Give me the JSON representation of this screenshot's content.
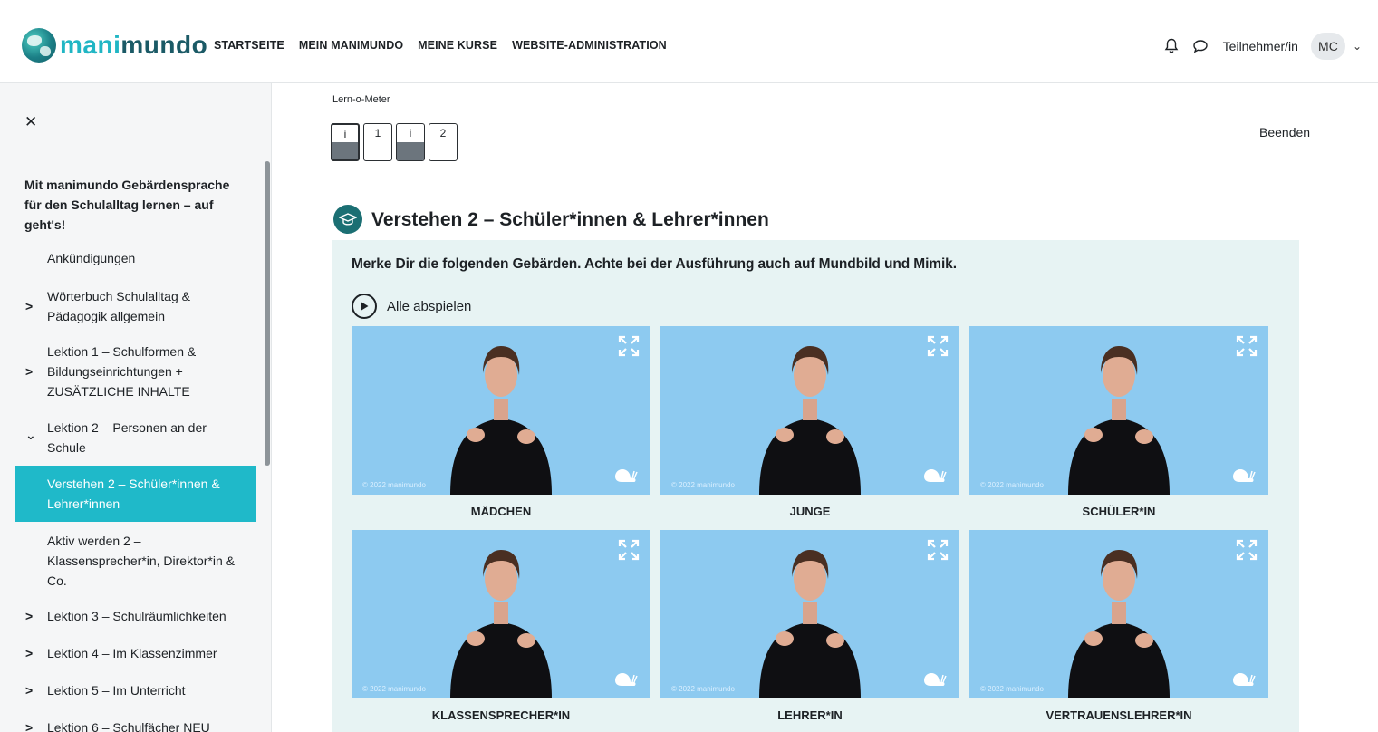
{
  "brand": {
    "logo_part1": "mani",
    "logo_part2": "mundo"
  },
  "topnav": {
    "items": [
      "STARTSEITE",
      "MEIN MANIMUNDO",
      "MEINE KURSE",
      "WEBSITE-ADMINISTRATION"
    ]
  },
  "user": {
    "role": "Teilnehmer/in",
    "initials": "MC"
  },
  "sidebar": {
    "course_title": "Mit manimundo Gebärdensprache für den Schulalltag lernen – auf geht's!",
    "items": [
      {
        "label": "Ankündigungen",
        "arrow": ""
      },
      {
        "label": "Wörterbuch Schulalltag & Pädagogik allgemein",
        "arrow": ">"
      },
      {
        "label": "Lektion 1 – Schulformen & Bildungseinrichtungen + ZUSÄTZLICHE INHALTE",
        "arrow": ">"
      },
      {
        "label": "Lektion 2 – Personen an der Schule",
        "arrow": "⌄"
      },
      {
        "label": "Verstehen 2 – Schüler*innen & Lehrer*innen",
        "arrow": ""
      },
      {
        "label": "Aktiv werden 2 – Klassensprecher*in, Direktor*in & Co.",
        "arrow": ""
      },
      {
        "label": "Lektion 3 – Schulräumlichkeiten",
        "arrow": ">"
      },
      {
        "label": "Lektion 4 – Im Klassenzimmer",
        "arrow": ">"
      },
      {
        "label": "Lektion 5 – Im Unterricht",
        "arrow": ">"
      },
      {
        "label": "Lektion 6 – Schulfächer NEU",
        "arrow": ">"
      }
    ]
  },
  "lern_o_meter": {
    "label": "Lern-o-Meter",
    "steps": [
      {
        "num": "i",
        "filled": true
      },
      {
        "num": "1",
        "filled": false
      },
      {
        "num": "i",
        "filled": true
      },
      {
        "num": "2",
        "filled": false
      }
    ]
  },
  "main": {
    "end_label": "Beenden",
    "section_title": "Verstehen 2 – Schüler*innen & Lehrer*innen",
    "instruction": "Merke Dir die folgenden Gebärden. Achte bei der Ausführung auch auf Mundbild und Mimik.",
    "play_all": "Alle abspielen",
    "video_copyright": "© 2022 manimundo",
    "signs": [
      "MÄDCHEN",
      "JUNGE",
      "SCHÜLER*IN",
      "KLASSENSPRECHER*IN",
      "LEHRER*IN",
      "VERTRAUENSLEHRER*IN"
    ]
  },
  "colors": {
    "accent": "#1fb9c9",
    "section_icon": "#1b6f73",
    "panel_bg": "#e7f3f3",
    "video_bg": "#8dcaf0"
  },
  "icons": [
    "bell-icon",
    "chat-icon",
    "close-icon",
    "play-circle-icon",
    "graduation-cap-icon",
    "fullscreen-icon",
    "snail-slow-icon",
    "chevron-down-icon"
  ]
}
